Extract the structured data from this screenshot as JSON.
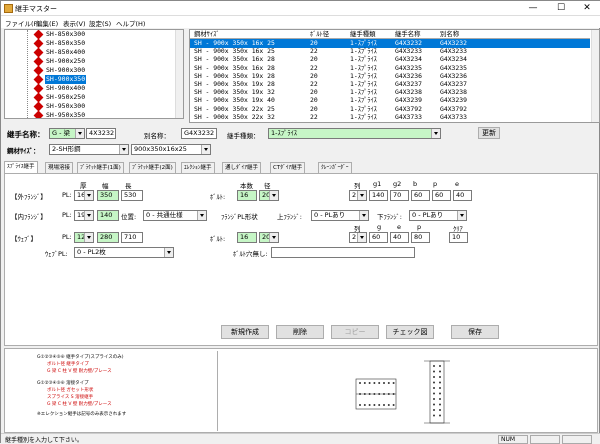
{
  "window": {
    "title": "継手マスター",
    "minimize": "—",
    "maximize": "☐",
    "close": "✕"
  },
  "menu": [
    "ファイル(F)",
    "編集(E)",
    "表示(V)",
    "設定(S)",
    "ヘルプ(H)"
  ],
  "tree": {
    "items": [
      "SH-850x300",
      "SH-850x350",
      "SH-850x400",
      "SH-900x250",
      "SH-900x300",
      "SH-900x350",
      "SH-900x400",
      "SH-950x250",
      "SH-950x300",
      "SH-950x350"
    ],
    "selected_index": 5
  },
  "grid": {
    "headers": [
      "鋼材ｻｲｽﾞ",
      "ﾎﾞﾙﾄ径",
      "継手種類",
      "継手名称",
      "別名称"
    ],
    "rows": [
      [
        "SH - 900x 350x 16x 25",
        "20",
        "1-ｽﾌﾟﾗｲｽ",
        "G4X3232",
        "G4X3232"
      ],
      [
        "SH - 900x 350x 16x 25",
        "22",
        "1-ｽﾌﾟﾗｲｽ",
        "G4X3233",
        "G4X3233"
      ],
      [
        "SH - 900x 350x 16x 28",
        "20",
        "1-ｽﾌﾟﾗｲｽ",
        "G4X3234",
        "G4X3234"
      ],
      [
        "SH - 900x 350x 16x 28",
        "22",
        "1-ｽﾌﾟﾗｲｽ",
        "G4X3235",
        "G4X3235"
      ],
      [
        "SH - 900x 350x 19x 28",
        "20",
        "1-ｽﾌﾟﾗｲｽ",
        "G4X3236",
        "G4X3236"
      ],
      [
        "SH - 900x 350x 19x 28",
        "22",
        "1-ｽﾌﾟﾗｲｽ",
        "G4X3237",
        "G4X3237"
      ],
      [
        "SH - 900x 350x 19x 32",
        "20",
        "1-ｽﾌﾟﾗｲｽ",
        "G4X3238",
        "G4X3238"
      ],
      [
        "SH - 900x 350x 19x 40",
        "20",
        "1-ｽﾌﾟﾗｲｽ",
        "G4X3239",
        "G4X3239"
      ],
      [
        "SH - 900x 350x 22x 25",
        "20",
        "1-ｽﾌﾟﾗｲｽ",
        "G4X3792",
        "G4X3792"
      ],
      [
        "SH - 900x 350x 22x 32",
        "22",
        "1-ｽﾌﾟﾗｲｽ",
        "G4X3733",
        "G4X3733"
      ]
    ],
    "selected_index": 0
  },
  "header_form": {
    "joint_name_label": "継手名称：",
    "joint_prefix": "G - 梁",
    "joint_code": "4X3232",
    "alias_label": "別名称：",
    "alias_value": "G4X3232",
    "joint_type_label": "継手種類：",
    "joint_type_value": "1-ｽﾌﾟﾗｲｽ",
    "update_button": "更新",
    "steel_size_label": "鋼材ｻｲｽﾞ：",
    "steel_kind": "2-SH形鋼",
    "steel_size": "900x350x16x25"
  },
  "tabs": [
    "ｽﾌﾟﾗｲｽ継手",
    "現場溶接",
    "ﾌﾞﾗｹｯﾄ継手(1面)",
    "ﾌﾞﾗｹｯﾄ継手(2面)",
    "ｴﾚｸｼｮﾝ継手",
    "通しﾀﾞｲｱ継手",
    "CTﾀﾞｲｱ継手",
    "ｸﾚｰﾝｶﾞｰﾀﾞｰ"
  ],
  "splice": {
    "col_thickness": "厚",
    "col_width": "幅",
    "col_length": "長",
    "col_count": "本数",
    "col_dia": "径",
    "col_row": "列",
    "col_g1": "g1",
    "col_g2": "g2",
    "col_b": "b",
    "col_p": "p",
    "col_e": "e",
    "outer_flange_label": "【外ﾌﾗﾝｼﾞ】",
    "pl": "PL:",
    "outer_thk": "16",
    "outer_width": "350",
    "outer_length": "530",
    "bolt_label": "ﾎﾞﾙﾄ:",
    "flange_bolt_count": "16",
    "flange_bolt_dia": "20",
    "flange_rows": "2",
    "flange_g1": "140",
    "flange_g2": "70",
    "flange_b": "60",
    "flange_p": "60",
    "flange_e": "40",
    "inner_flange_label": "【内ﾌﾗﾝｼﾞ】",
    "inner_thk": "19",
    "inner_width": "140",
    "position_label": "位置:",
    "position_value": "0 - 共通仕様",
    "flange_pl_shape_label": "ﾌﾗﾝｼﾞPL形状",
    "upper_flange_label": "上ﾌﾗﾝｼﾞ:",
    "upper_flange_value": "0 - PLあり",
    "lower_flange_label": "下ﾌﾗﾝｼﾞ:",
    "lower_flange_value": "0 - PLあり",
    "web_label": "【ｳｪﾌﾞ】",
    "web_thk": "12",
    "web_width": "280",
    "web_length": "710",
    "web_col_row": "列",
    "web_col_g": "g",
    "web_col_e": "e",
    "web_col_p": "p",
    "web_col_clear": "ｸﾘｱ",
    "web_bolt_count": "16",
    "web_bolt_dia": "20",
    "web_rows": "2",
    "web_g": "60",
    "web_e": "40",
    "web_p": "80",
    "web_clear": "10",
    "web_pl_label": "ｳｪﾌﾞPL:",
    "web_pl_value": "0 - PL2枚",
    "bolt_hole_label": "ﾎﾞﾙﾄ穴無し:",
    "bolt_hole_value": ""
  },
  "buttons": {
    "new": "新規作成",
    "delete": "削除",
    "copy": "コピー",
    "check": "チェック図",
    "save": "保存"
  },
  "legend": {
    "line1": "G①②③④⑤⑥ 継手タイプ(スプライスのみ)",
    "line2": "ボルト径 継手タイプ",
    "line3": "G 梁 C 柱 V 壁 耐力壁/ブレース",
    "line4": "G①②③④⑤⑥ 溶接タイプ",
    "line5": "ボルト径 ガセット形状",
    "line6": "スプライス S 溶接継手",
    "line7": "G 梁 C 柱 V 壁 耐力壁/ブレース",
    "line8": "※エレクション継手は記号のみ表示されます"
  },
  "status": {
    "text": "継手種別を入力して下さい。",
    "num": "NUM"
  }
}
